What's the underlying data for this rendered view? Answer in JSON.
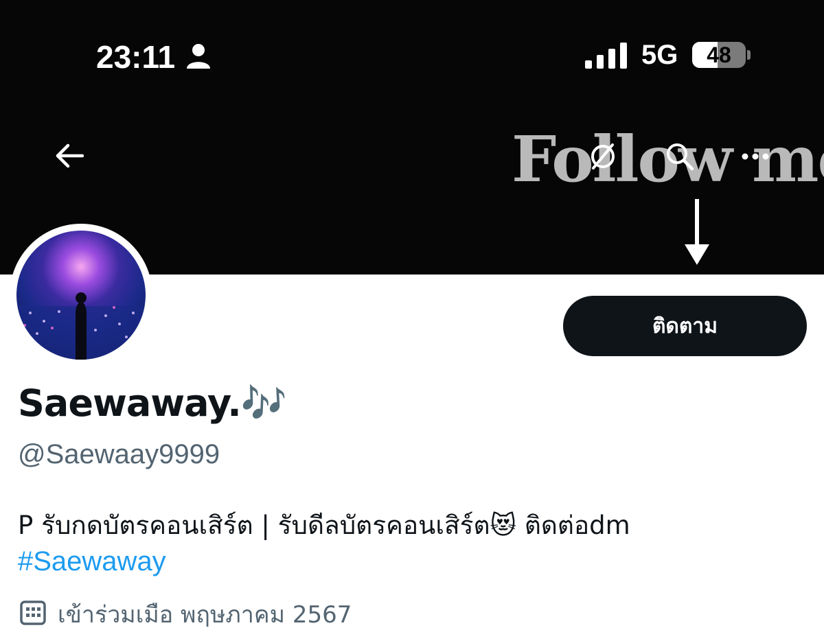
{
  "status_bar": {
    "time": "23:11",
    "network": "5G",
    "battery": "48",
    "battery_level": 0.48
  },
  "banner": {
    "text": "Follow me"
  },
  "nav": {
    "back_icon": "arrow-left-icon",
    "icons": [
      "no-animation-icon",
      "search-icon",
      "more-icon"
    ]
  },
  "profile": {
    "follow_label": "ติดตาม",
    "display_name": "Saewaway.🎶",
    "handle": "@Saewaay9999",
    "bio": "P รับกดบัตรคอนเสิร์ต | รับดีลบัตรคอนเสิร์ต😻 ติดต่อdm",
    "hashtag": "#Saewaway",
    "joined": "เข้าร่วมเมือ พฤษภาคม 2567"
  },
  "colors": {
    "primary_text": "#0f1419",
    "secondary_text": "#536471",
    "link": "#1d9bf0",
    "follow_button_bg": "#0f1419"
  }
}
